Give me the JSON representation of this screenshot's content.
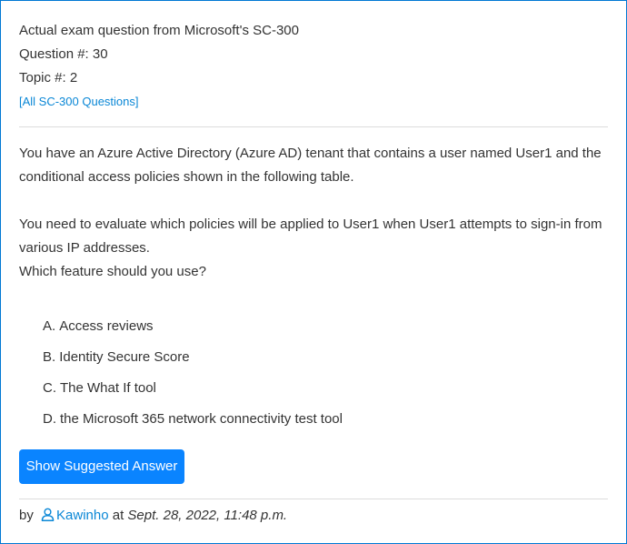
{
  "header": {
    "line1": "Actual exam question from Microsoft's SC-300",
    "question_number": "Question #: 30",
    "topic": "Topic #: 2",
    "all_questions_link": "[All SC-300 Questions]"
  },
  "question": {
    "paragraph1": "You have an Azure Active Directory (Azure AD) tenant that contains a user named User1 and the conditional access policies shown in the following table.",
    "paragraph2_line1": "You need to evaluate which policies will be applied to User1 when User1 attempts to sign-in from various IP addresses.",
    "paragraph2_line2": "Which feature should you use?"
  },
  "choices": [
    {
      "letter": "A.",
      "text": "Access reviews"
    },
    {
      "letter": "B.",
      "text": "Identity Secure Score"
    },
    {
      "letter": "C.",
      "text": "The What If tool"
    },
    {
      "letter": "D.",
      "text": "the Microsoft 365 network connectivity test tool"
    }
  ],
  "button": {
    "label": "Show Suggested Answer"
  },
  "meta": {
    "by": "by",
    "author": "Kawinho",
    "at": "at",
    "date": "Sept. 28, 2022, 11:48 p.m."
  },
  "colors": {
    "border": "#0078d4",
    "link": "#0a87d6",
    "button_bg": "#0a84ff",
    "text": "#333333"
  }
}
